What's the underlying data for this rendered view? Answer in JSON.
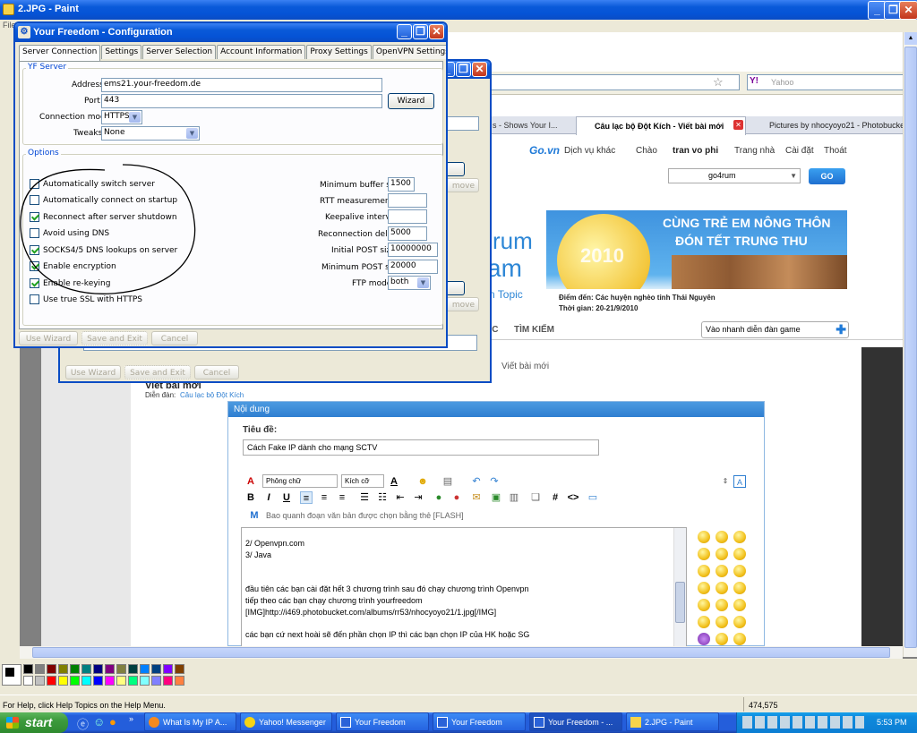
{
  "paint": {
    "title": "2.JPG - Paint",
    "menu_label": "File",
    "status_help": "For Help, click Help Topics on the Help Menu.",
    "coords": "474,575"
  },
  "browser": {
    "search_placeholder": "Yahoo",
    "tabs": [
      "s - Shows Your I...",
      "Câu lạc bộ Đột Kích - Viết bài mới",
      "Pictures by nhocyoyo21 - Photobucket"
    ],
    "go_logo": "Go.vn",
    "nav": [
      "Dịch vụ khác",
      "Chào",
      "tran vo phi",
      "Trang nhà",
      "Cài đặt",
      "Thoát"
    ],
    "forum_select": "go4rum",
    "go_button": "GO",
    "banner": {
      "title1": "CÙNG TRẺ EM NÔNG THÔN",
      "title2": "ĐÓN TẾT TRUNG THU",
      "year": "2010",
      "place": "Điểm đến: Các huyện nghèo tỉnh Thái Nguyên",
      "time": "Thời gian: 20-21/9/2010",
      "frag1": "rum",
      "frag2": "am",
      "frag3": "n Topic"
    },
    "menubar": {
      "item1": "ẮC",
      "item2": "TÌM KIẾM",
      "quick": "Vào nhanh diễn đàn game"
    },
    "crumb": "Viết bài mới",
    "page_title": "Viết bài mới",
    "forum_line": "Diễn đàn:",
    "forum_link": "Câu lạc bộ Đột Kích",
    "content_header": "Nội dung",
    "subject_label": "Tiêu đề:",
    "subject_value": "Cách Fake IP dành cho mạng SCTV",
    "font_select": "Phông chữ",
    "size_select": "Kích cỡ",
    "flash_hint": "Bao quanh đoạn văn bản được chọn bằng thẻ [FLASH]",
    "editor_lines": [
      "2/ Openvpn.com",
      "3/ Java",
      "",
      "đầu tiên các bạn cài đặt hết 3 chương trình sau đó chạy chương trình Openvpn",
      "tiếp theo các bạn chạy chương trình yourfreedom",
      "[IMG]http://i469.photobucket.com/albums/rr53/nhocyoyo21/1.jpg[/IMG]",
      "",
      "các bạn cứ next hoài sẽ đến phần chọn IP thì các bạn chọn IP của HK hoặc SG"
    ]
  },
  "dialog2": {
    "buttons": [
      "Use Wizard",
      "Save and Exit",
      "Cancel"
    ],
    "btn_frag": "move"
  },
  "dialog": {
    "title": "Your Freedom - Configuration",
    "tabs": [
      "Server Connection",
      "Settings",
      "Server Selection",
      "Account Information",
      "Proxy Settings",
      "OpenVPN Settings"
    ],
    "yf_server": "YF Server",
    "address_label": "Address",
    "address_value": "ems21.your-freedom.de",
    "port_label": "Port",
    "port_value": "443",
    "wizard": "Wizard",
    "mode_label": "Connection mode",
    "mode_value": "HTTPS",
    "tweaks_label": "Tweaks",
    "tweaks_value": "None",
    "options": "Options",
    "checks": [
      {
        "label": "Automatically switch server",
        "checked": false
      },
      {
        "label": "Automatically connect on startup",
        "checked": false
      },
      {
        "label": "Reconnect after server shutdown",
        "checked": true
      },
      {
        "label": "Avoid using DNS",
        "checked": false
      },
      {
        "label": "SOCKS4/5 DNS lookups on server",
        "checked": true
      },
      {
        "label": "Enable encryption",
        "checked": true
      },
      {
        "label": "Enable re-keying",
        "checked": true
      },
      {
        "label": "Use true SSL with HTTPS",
        "checked": false
      }
    ],
    "right": [
      {
        "label": "Minimum buffer size",
        "value": "1500"
      },
      {
        "label": "RTT measurements",
        "value": ""
      },
      {
        "label": "Keepalive interval",
        "value": ""
      },
      {
        "label": "Reconnection delay",
        "value": "5000"
      },
      {
        "label": "Initial POST size",
        "value": "10000000"
      },
      {
        "label": "Minimum POST size",
        "value": "20000"
      },
      {
        "label": "FTP mode",
        "value": "both"
      }
    ],
    "buttons": [
      "Use Wizard",
      "Save and Exit",
      "Cancel"
    ]
  },
  "taskbar": {
    "start": "start",
    "items": [
      "What Is My IP A...",
      "Yahoo! Messenger",
      "Your Freedom",
      "Your Freedom",
      "Your Freedom - ...",
      "2.JPG - Paint"
    ],
    "clock": "5:53 PM"
  },
  "colors": {
    "xp_blue": "#0a5ad9",
    "taskbar": "#245edb",
    "start_green": "#3c9a3c",
    "dialog_bg": "#ece9d8",
    "forum_blue": "#2f7fd1"
  },
  "palette": [
    "#000000",
    "#808080",
    "#800000",
    "#808000",
    "#008000",
    "#008080",
    "#000080",
    "#800080",
    "#808040",
    "#004040",
    "#0080ff",
    "#004080",
    "#8000ff",
    "#804000",
    "#ffffff",
    "#c0c0c0",
    "#ff0000",
    "#ffff00",
    "#00ff00",
    "#00ffff",
    "#0000ff",
    "#ff00ff",
    "#ffff80",
    "#00ff80",
    "#80ffff",
    "#8080ff",
    "#ff0080",
    "#ff8040"
  ]
}
